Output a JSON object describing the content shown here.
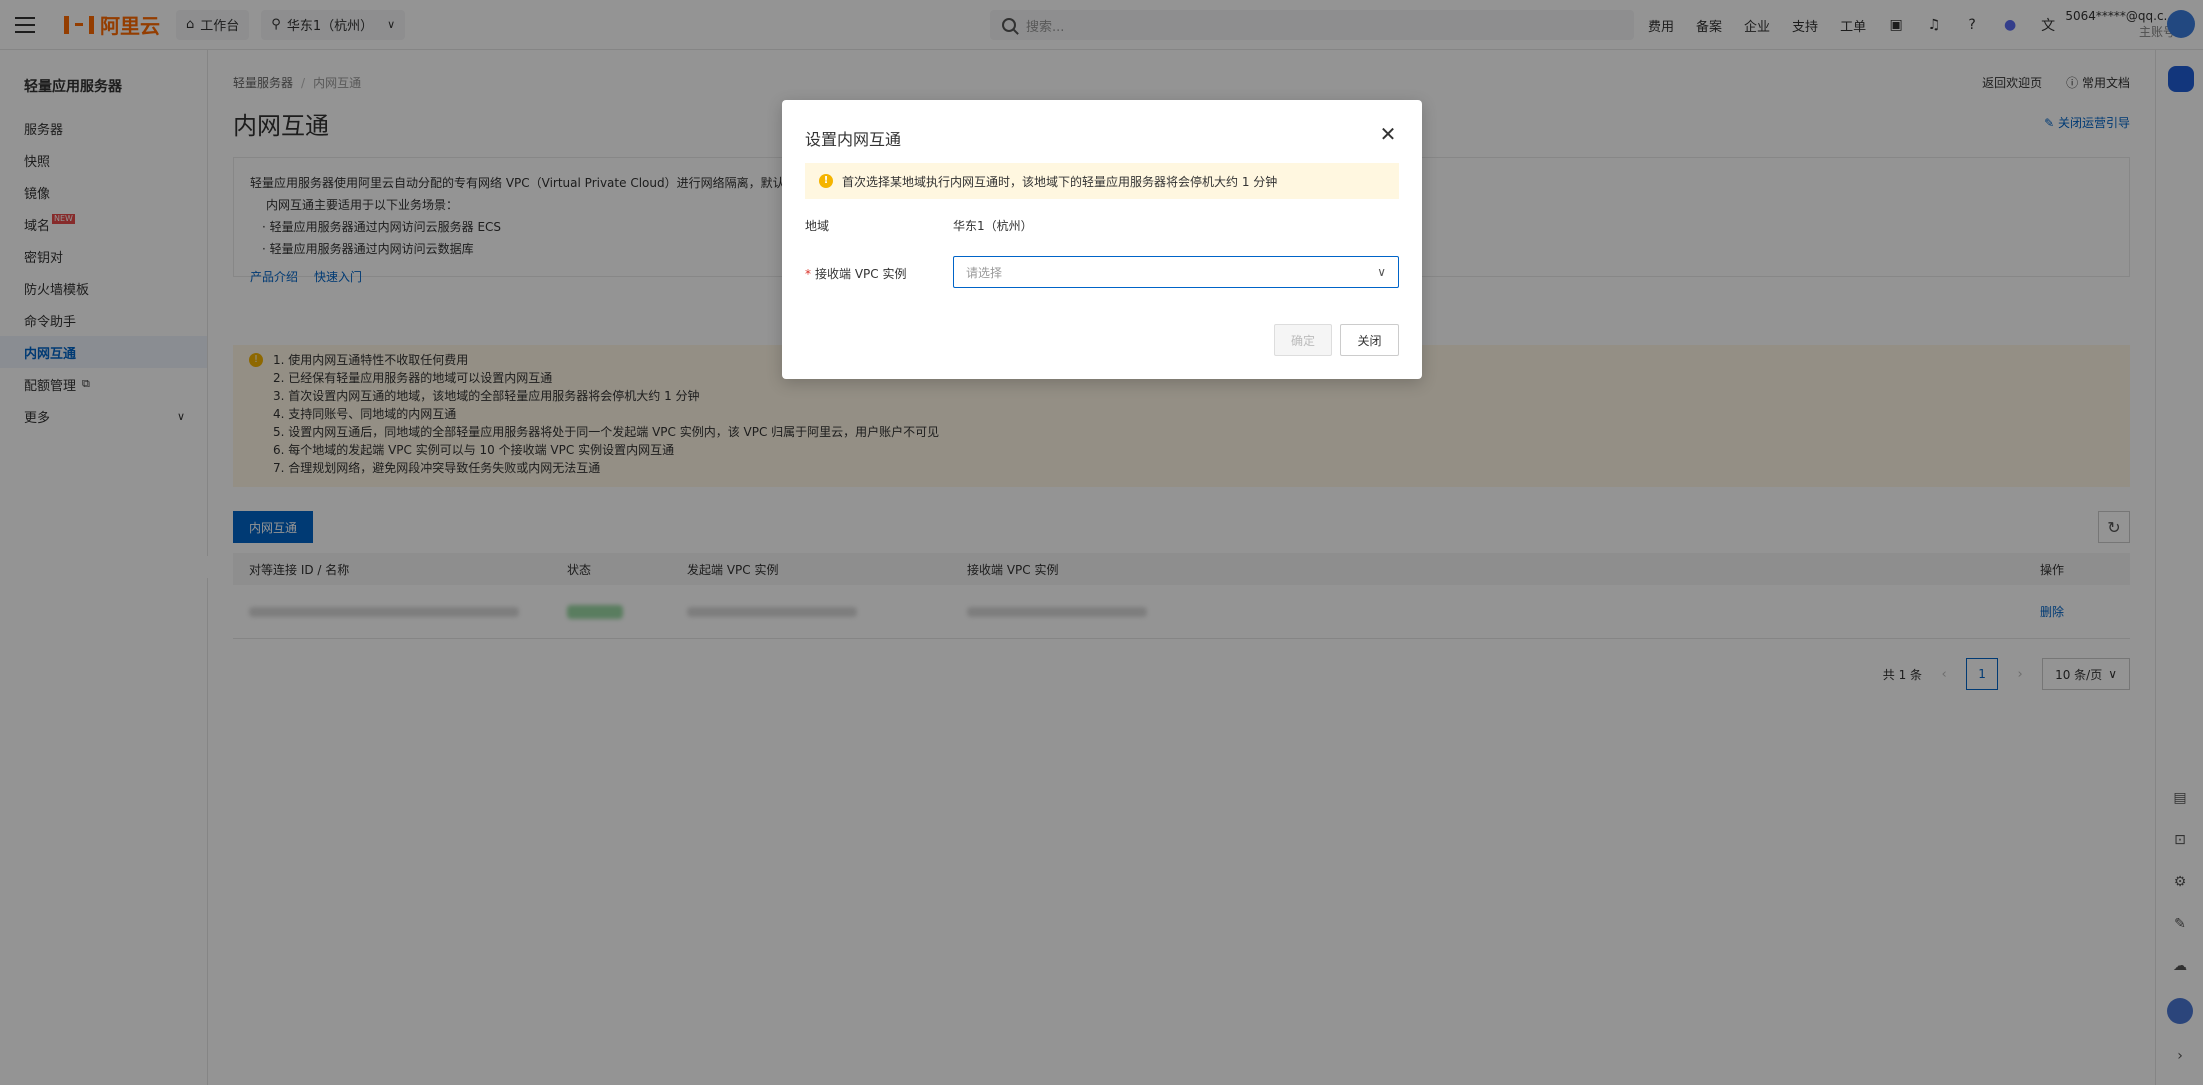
{
  "topbar": {
    "logo_text": "阿里云",
    "workbench": "工作台",
    "region": "华东1（杭州）",
    "search_placeholder": "搜索...",
    "nav": [
      "费用",
      "备案",
      "企业",
      "支持",
      "工单"
    ],
    "user_account": "5064*****@qq.c...",
    "user_role": "主账号"
  },
  "sidebar": {
    "title": "轻量应用服务器",
    "items": [
      "服务器",
      "快照",
      "镜像",
      "域名",
      "密钥对",
      "防火墙模板",
      "命令助手",
      "内网互通",
      "配额管理",
      "更多"
    ],
    "new_badge": "NEW",
    "active_index": 7
  },
  "main": {
    "breadcrumb": [
      "轻量服务器",
      "内网互通"
    ],
    "title": "内网互通",
    "top_links": [
      "返回欢迎页",
      "常用文档"
    ],
    "guide_link": "关闭运营引导",
    "intro": {
      "line1": "轻量应用服务器使用阿里云自动分配的专有网络 VPC（Virtual Private Cloud）进行网络隔离，默认情",
      "line2": "内网互通主要适用于以下业务场景：",
      "bullets": [
        "轻量应用服务器通过内网访问云服务器 ECS",
        "轻量应用服务器通过内网访问云数据库"
      ],
      "links": [
        "产品介绍",
        "快速入门"
      ]
    },
    "notices": [
      "1. 使用内网互通特性不收取任何费用",
      "2. 已经保有轻量应用服务器的地域可以设置内网互通",
      "3. 首次设置内网互通的地域，该地域的全部轻量应用服务器将会停机大约 1 分钟",
      "4. 支持同账号、同地域的内网互通",
      "5. 设置内网互通后，同地域的全部轻量应用服务器将处于同一个发起端 VPC 实例内，该 VPC 归属于阿里云，用户账户不可见",
      "6. 每个地域的发起端 VPC 实例可以与 10 个接收端 VPC 实例设置内网互通",
      "7. 合理规划网络，避免网段冲突导致任务失败或内网无法互通"
    ],
    "primary_button": "内网互通",
    "table": {
      "headers": [
        "对等连接 ID / 名称",
        "状态",
        "发起端 VPC 实例",
        "接收端 VPC 实例",
        "操作"
      ],
      "row_action": "删除"
    },
    "pagination": {
      "total": "共 1 条",
      "current_page": "1",
      "page_size": "10 条/页"
    }
  },
  "modal": {
    "title": "设置内网互通",
    "alert": "首次选择某地域执行内网互通时，该地域下的轻量应用服务器将会停机大约 1 分钟",
    "region_label": "地域",
    "region_value": "华东1（杭州）",
    "vpc_label": "接收端 VPC 实例",
    "vpc_placeholder": "请选择",
    "confirm_button": "确定",
    "close_button": "关闭"
  },
  "colors": {
    "primary": "#0064c8",
    "brand": "#ff6a00",
    "warning": "#f5b400"
  }
}
